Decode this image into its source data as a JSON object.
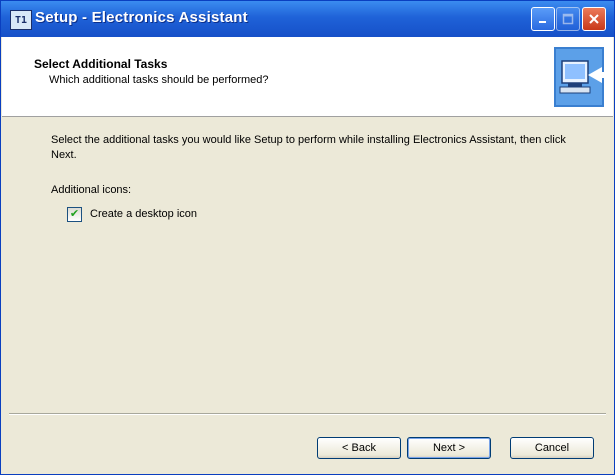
{
  "window": {
    "title": "Setup - Electronics Assistant",
    "app_icon_text": "T1"
  },
  "header": {
    "title": "Select Additional Tasks",
    "subtitle": "Which additional tasks should be performed?",
    "logo_icon": "computer-setup-icon"
  },
  "content": {
    "instructions": "Select the additional tasks you would like Setup to perform while installing Electronics Assistant, then click Next.",
    "group_label": "Additional icons:",
    "tasks": [
      {
        "label": "Create a desktop icon",
        "checked": true,
        "check_glyph": "✔"
      }
    ]
  },
  "buttons": {
    "back": "< Back",
    "next": "Next >",
    "cancel": "Cancel"
  },
  "colors": {
    "titlebar": "#1f62d8",
    "dialog_bg": "#ece9d8",
    "header_bg": "#ffffff",
    "close_button": "#c8381a"
  }
}
